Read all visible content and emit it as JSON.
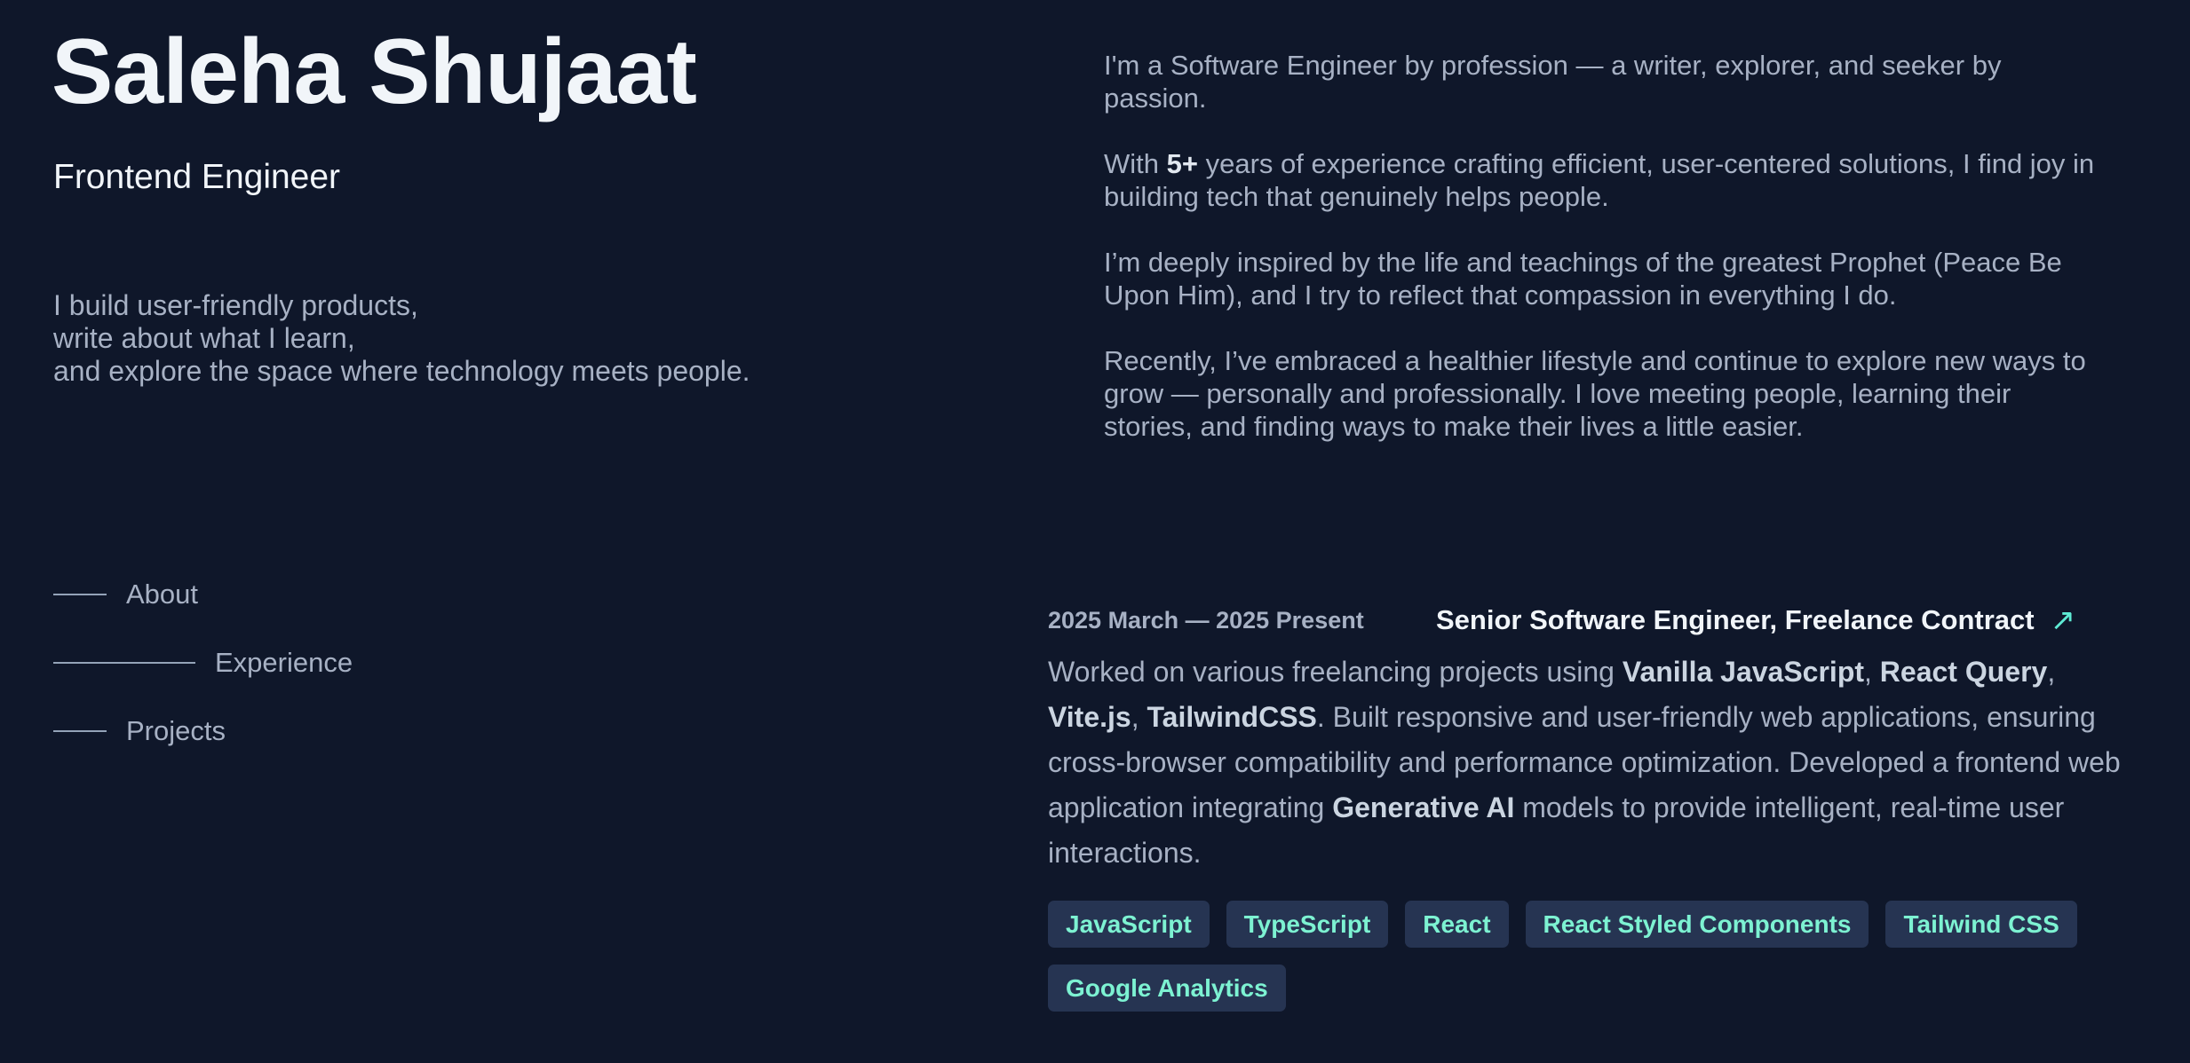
{
  "header": {
    "name": "Saleha Shujaat",
    "role": "Frontend Engineer",
    "tagline": [
      "I build user-friendly products,",
      "write about what I learn,",
      "and explore the space where technology meets people."
    ]
  },
  "nav": [
    {
      "label": "About",
      "active": false
    },
    {
      "label": "Experience",
      "active": true
    },
    {
      "label": "Projects",
      "active": false
    }
  ],
  "about": {
    "p1": "I'm a Software Engineer by profession — a writer, explorer, and seeker by passion.",
    "p2_pre": "With ",
    "p2_bold": "5+",
    "p2_post": " years of experience crafting efficient, user-centered solutions, I find joy in building tech that genuinely helps people.",
    "p3": "I’m deeply inspired by the life and teachings of the greatest Prophet (Peace Be Upon Him), and I try to reflect that compassion in everything I do.",
    "p4": "Recently, I’ve embraced a healthier lifestyle and continue to explore new ways to grow — personally and professionally. I love meeting people, learning their stories, and finding ways to make their lives a little easier."
  },
  "experience": {
    "date": "2025 March — 2025 Present",
    "title": "Senior Software Engineer, Freelance Contract",
    "arrow_icon": "↗",
    "desc": [
      {
        "t": "Worked on various freelancing projects using ",
        "b": false
      },
      {
        "t": "Vanilla JavaScript",
        "b": true
      },
      {
        "t": ", ",
        "b": false
      },
      {
        "t": "React Query",
        "b": true
      },
      {
        "t": ", ",
        "b": false
      },
      {
        "t": "Vite.js",
        "b": true
      },
      {
        "t": ", ",
        "b": false
      },
      {
        "t": "TailwindCSS",
        "b": true
      },
      {
        "t": ". Built responsive and user-friendly web applications, ensuring cross-browser compatibility and performance optimization. Developed a frontend web application integrating ",
        "b": false
      },
      {
        "t": "Generative AI",
        "b": true
      },
      {
        "t": " models to provide intelligent, real-time user interactions.",
        "b": false
      }
    ],
    "tags": [
      "JavaScript",
      "TypeScript",
      "React",
      "React Styled Components",
      "Tailwind CSS",
      "Google Analytics"
    ]
  },
  "colors": {
    "background": "#0f172a",
    "accent": "#5eead4",
    "tag_bg": "#263452"
  }
}
